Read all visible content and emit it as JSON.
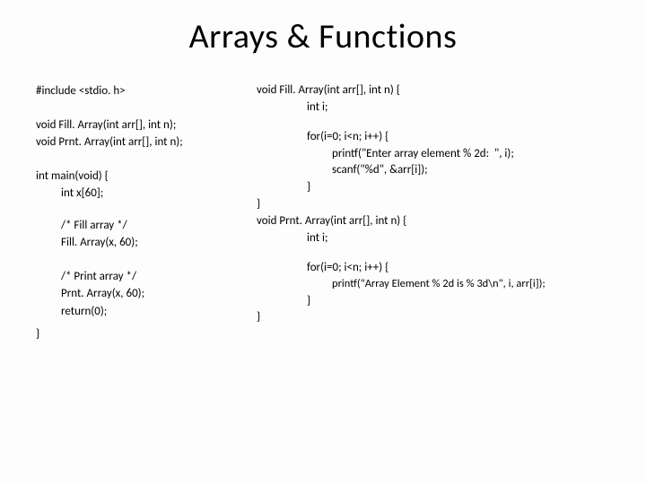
{
  "title": "Arrays & Functions",
  "left": {
    "l1": "#include <stdio. h>",
    "l2": "void Fill. Array(int arr[], int n);",
    "l3": "void Prnt. Array(int arr[], int n);",
    "l4": "int main(void) {",
    "l5": "int x[60];",
    "l6": "/* Fill array */",
    "l7": "Fill. Array(x, 60);",
    "l8": "/* Print array */",
    "l9": "Prnt. Array(x, 60);",
    "l10": "return(0);",
    "l11": "}"
  },
  "right": {
    "r1": "void Fill. Array(int arr[], int n) {",
    "r2": "int i;",
    "r3": "for(i=0; i<n; i++) {",
    "r4": "printf(\"Enter array element % 2d:  \", i);",
    "r5": "scanf(\"%d\", &arr[i]);",
    "r6": "}",
    "r7": "}",
    "r8": "void Prnt. Array(int arr[], int n) {",
    "r9": "int i;",
    "r10": "for(i=0; i<n; i++) {",
    "r11": "printf(\"Array Element % 2d is % 3d\\n\", i, arr[i]);",
    "r12": "}",
    "r13": "}"
  }
}
